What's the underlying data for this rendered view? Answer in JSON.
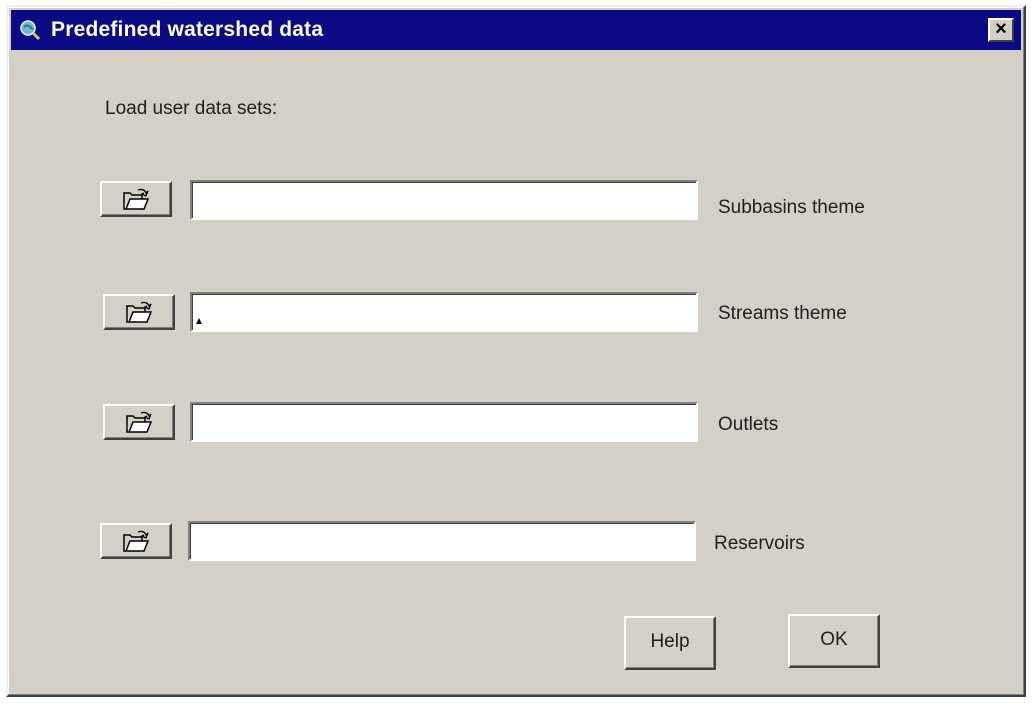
{
  "window": {
    "title": "Predefined watershed data",
    "close_label": "×"
  },
  "dialog": {
    "heading": "Load user data sets:",
    "rows": [
      {
        "label": "Subbasins theme",
        "value": "",
        "browse_icon": "open-folder-icon"
      },
      {
        "label": "Streams theme",
        "value": "",
        "browse_icon": "open-folder-icon"
      },
      {
        "label": "Outlets",
        "value": "",
        "browse_icon": "open-folder-icon"
      },
      {
        "label": "Reservoirs",
        "value": "",
        "browse_icon": "open-folder-icon"
      }
    ],
    "help_label": "Help",
    "ok_label": "OK"
  },
  "colors": {
    "titlebar": "#0a0a84",
    "face": "#d4d0c8"
  }
}
